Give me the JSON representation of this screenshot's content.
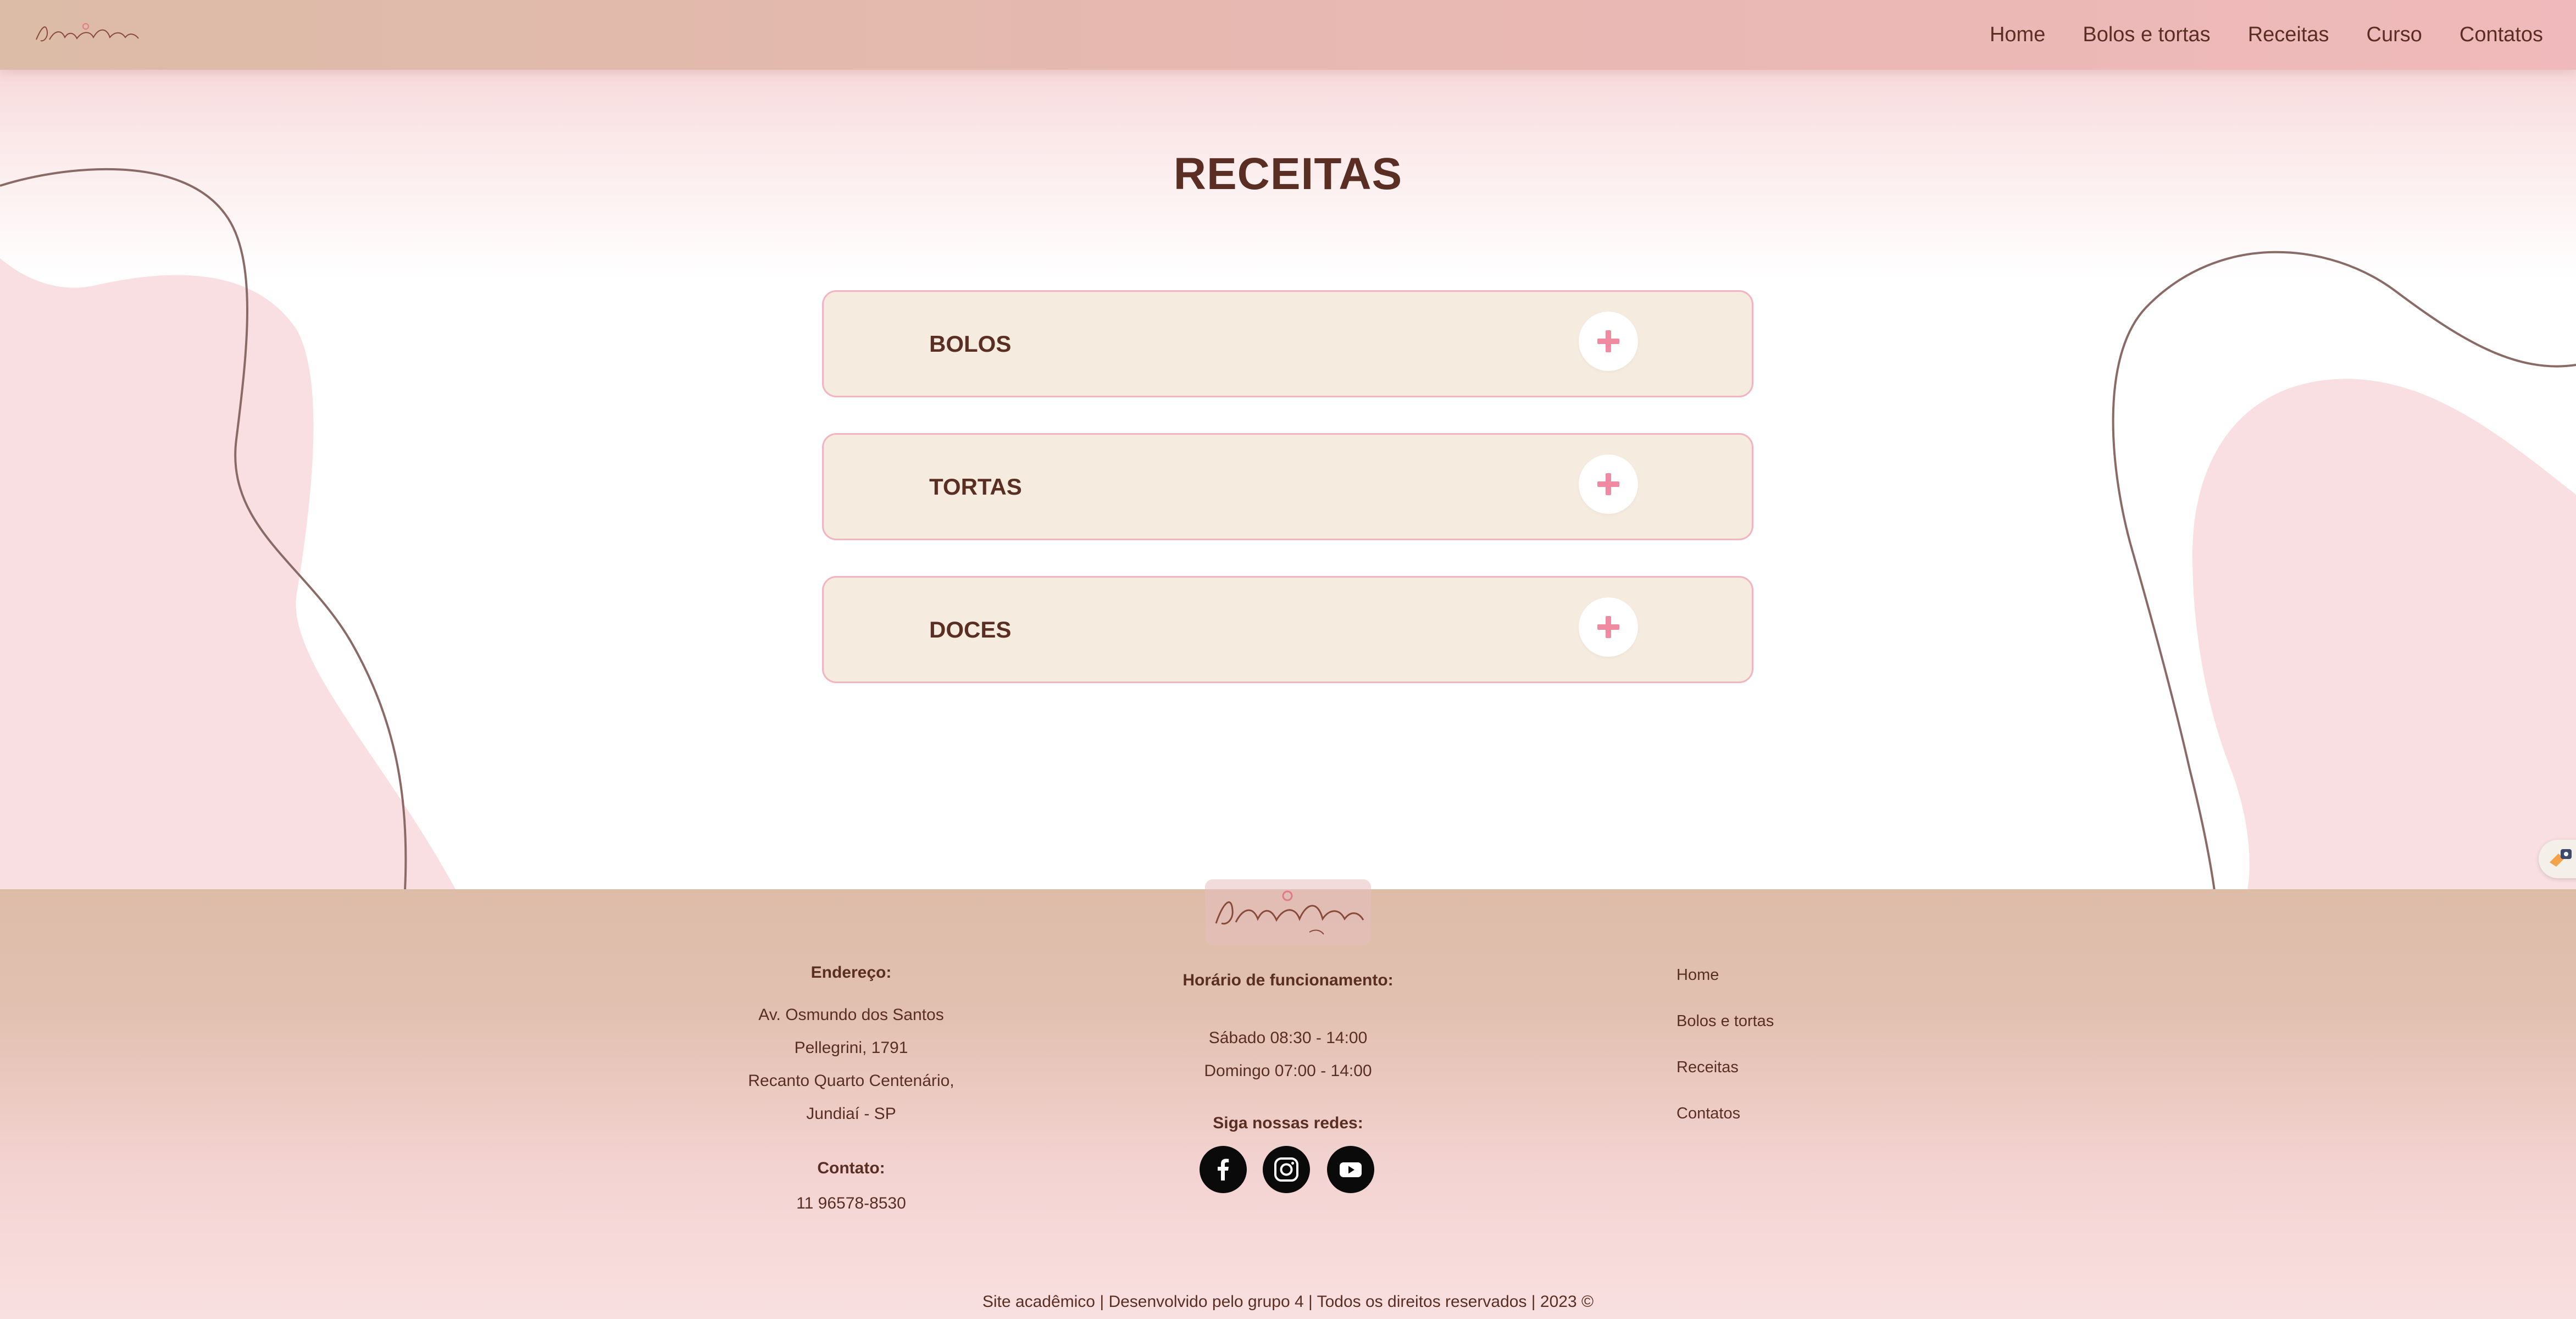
{
  "brand": {
    "logo_text": "Andreia Gazoli"
  },
  "nav": {
    "items": [
      {
        "label": "Home"
      },
      {
        "label": "Bolos e tortas"
      },
      {
        "label": "Receitas"
      },
      {
        "label": "Curso"
      },
      {
        "label": "Contatos"
      }
    ]
  },
  "page": {
    "title": "RECEITAS"
  },
  "accordion": {
    "items": [
      {
        "label": "BOLOS",
        "icon": "plus-icon"
      },
      {
        "label": "TORTAS",
        "icon": "plus-icon"
      },
      {
        "label": "DOCES",
        "icon": "plus-icon"
      }
    ]
  },
  "footer": {
    "address": {
      "heading": "Endereço:",
      "lines": [
        "Av. Osmundo dos Santos",
        "Pellegrini, 1791",
        "Recanto Quarto Centenário,",
        "Jundiaí - SP"
      ]
    },
    "contact": {
      "heading": "Contato:",
      "phone": "11 96578-8530"
    },
    "hours": {
      "heading": "Horário de funcionamento:",
      "lines": [
        "Sábado 08:30 - 14:00",
        "Domingo 07:00 - 14:00"
      ]
    },
    "social": {
      "heading": "Siga nossas redes:",
      "icons": [
        "facebook-icon",
        "instagram-icon",
        "youtube-icon"
      ]
    },
    "links": [
      {
        "label": "Home"
      },
      {
        "label": "Bolos e tortas"
      },
      {
        "label": "Receitas"
      },
      {
        "label": "Contatos"
      }
    ],
    "copyright": "Site acadêmico | Desenvolvido pelo grupo 4 | Todos os direitos reservados | 2023 ©"
  },
  "colors": {
    "accent": "#f08aa0",
    "text": "#5a2e22",
    "card_bg": "#f5ebdf",
    "card_border": "#f4b3c0",
    "blob_pink": "#f9dfe1",
    "header_start": "#dcbba7",
    "header_end": "#f0b9bb"
  }
}
